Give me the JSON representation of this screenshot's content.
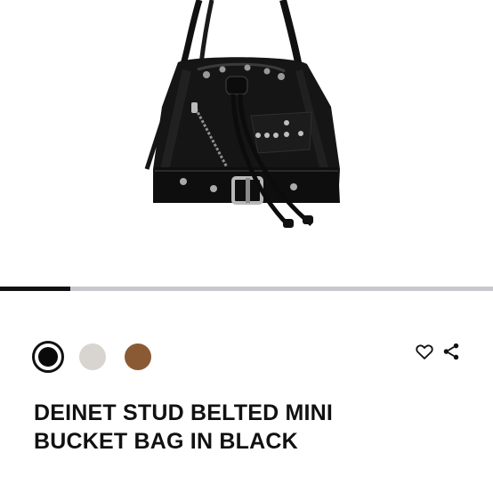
{
  "product": {
    "image_alt": "DEINET STUD BELTED MINI BUCKET BAG IN BLACK",
    "title_lines": [
      "DEINET STUD BELTED MINI",
      "BUCKET BAG IN BLACK"
    ]
  },
  "gallery": {
    "progress": 0.143
  },
  "colors": [
    {
      "name": "black",
      "hex": "#0a0a0a",
      "selected": true
    },
    {
      "name": "grey",
      "hex": "#d8d4cf",
      "selected": false
    },
    {
      "name": "brown",
      "hex": "#8a5a34",
      "selected": false
    }
  ],
  "actions": {
    "wishlist_icon": "heart-icon",
    "share_icon": "share-icon"
  }
}
